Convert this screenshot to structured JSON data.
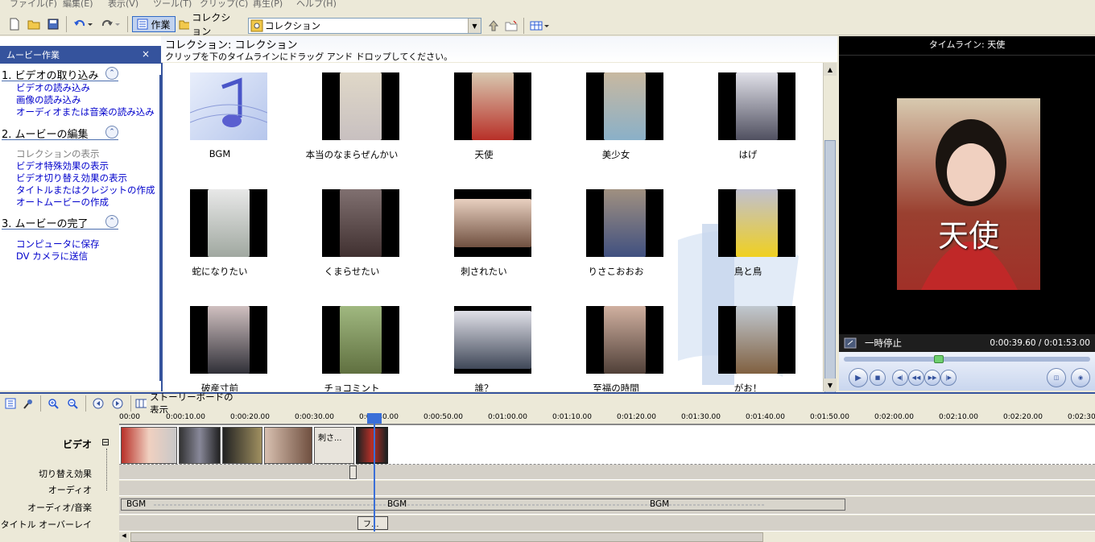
{
  "menu": [
    "ファイル(F)",
    "編集(E)",
    "表示(V)",
    "ツール(T)",
    "クリップ(C)",
    "再生(P)",
    "ヘルプ(H)"
  ],
  "toolbar": {
    "task_label": "作業",
    "collection_label": "コレクション",
    "select_value": "コレクション"
  },
  "taskpane": {
    "title": "ムービー作業",
    "close": "×",
    "sections": [
      {
        "title": "1. ビデオの取り込み",
        "links": [
          "ビデオの読み込み",
          "画像の読み込み",
          "オーディオまたは音楽の読み込み"
        ]
      },
      {
        "title": "2. ムービーの編集",
        "links": [
          "コレクションの表示",
          "ビデオ特殊効果の表示",
          "ビデオ切り替え効果の表示",
          "タイトルまたはクレジットの作成",
          "オートムービーの作成"
        ]
      },
      {
        "title": "3. ムービーの完了",
        "links": [
          "コンピュータに保存",
          "DV カメラに送信"
        ]
      }
    ]
  },
  "collection": {
    "title": "コレクション: コレクション",
    "subtitle": "クリップを下のタイムラインにドラッグ アンド ドロップしてください。",
    "clips": [
      "BGM",
      "本当のなまらぜんかい",
      "天使",
      "美少女",
      "はげ",
      "蛇になりたい",
      "くまらせたい",
      "刺されたい",
      "りさこおおお",
      "鳥と鳥",
      "破産寸前",
      "チョコミント",
      "誰？",
      "至福の時間",
      "がお！"
    ]
  },
  "preview": {
    "title": "タイムライン: 天使",
    "caption": "天使",
    "status": "一時停止",
    "time": "0:00:39.60 / 0:01:53.00"
  },
  "timeline": {
    "storyboard_label": "ストーリーボードの表示",
    "ticks": [
      "00:00",
      "0:00:10.00",
      "0:00:20.00",
      "0:00:30.00",
      "0:00:40.00",
      "0:00:50.00",
      "0:01:00.00",
      "0:01:10.00",
      "0:01:20.00",
      "0:01:30.00",
      "0:01:40.00",
      "0:01:50.00",
      "0:02:00.00",
      "0:02:10.00",
      "0:02:20.00",
      "0:02:30"
    ],
    "tracks": [
      "ビデオ",
      "切り替え効果",
      "オーディオ",
      "オーディオ/音楽",
      "タイトル オーバーレイ"
    ],
    "video_text_clip": "刺さ...",
    "bgm_labels": [
      "BGM",
      "BGM",
      "BGM"
    ],
    "title_clip": "フ...",
    "expand": "⊟"
  }
}
